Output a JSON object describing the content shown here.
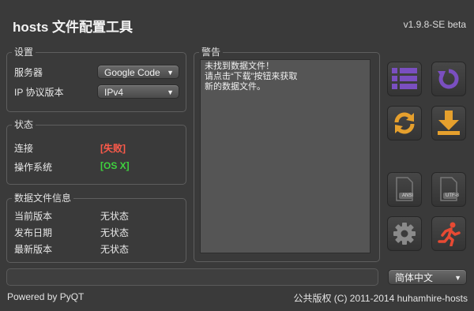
{
  "header": {
    "title": "hosts 文件配置工具",
    "version": "v1.9.8-SE beta"
  },
  "settings": {
    "title": "设置",
    "server_label": "服务器",
    "server_value": "Google Code",
    "ip_label": "IP 协议版本",
    "ip_value": "IPv4"
  },
  "status": {
    "title": "状态",
    "connection_label": "连接",
    "connection_value": "[失败]",
    "os_label": "操作系统",
    "os_value": "[OS X]",
    "colors": {
      "fail": "#ff5a4a",
      "ok": "#3ed23e"
    }
  },
  "datafile": {
    "title": "数据文件信息",
    "current_label": "当前版本",
    "current_value": "无状态",
    "release_label": "发布日期",
    "release_value": "无状态",
    "latest_label": "最新版本",
    "latest_value": "无状态"
  },
  "warning": {
    "title": "警告",
    "text": "未找到数据文件！\n请点击“下载”按钮来获取\n新的数据文件。"
  },
  "toolbar": {
    "icons": [
      "list-icon",
      "refresh-circle-icon",
      "sync-icon",
      "download-icon",
      "ansi-file-icon",
      "utf8-file-icon",
      "gear-icon",
      "running-man-icon"
    ],
    "ansi_label": "ANSI",
    "utf8_label": "UTF-8",
    "accent_purple": "#7a4fc0",
    "accent_orange": "#e6a02d",
    "accent_red": "#e84a33"
  },
  "language": {
    "value": "简体中文"
  },
  "footer": {
    "powered": "Powered by PyQT",
    "copyright": "公共版权 (C) 2011-2014 huhamhire-hosts"
  }
}
